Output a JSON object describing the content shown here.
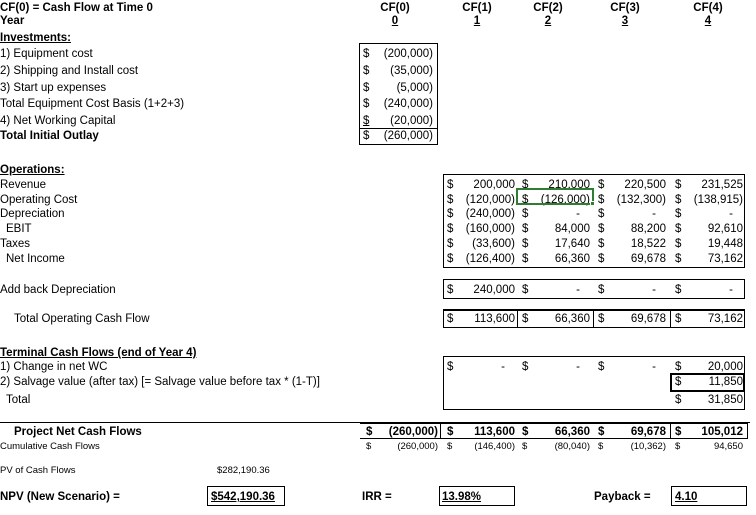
{
  "header": {
    "title": "CF(0) = Cash Flow at Time 0",
    "year_label": "Year",
    "columns": [
      {
        "label": "CF(0)",
        "year": "0"
      },
      {
        "label": "CF(1)",
        "year": "1"
      },
      {
        "label": "CF(2)",
        "year": "2"
      },
      {
        "label": "CF(3)",
        "year": "3"
      },
      {
        "label": "CF(4)",
        "year": "4"
      }
    ]
  },
  "investments": {
    "heading": "Investments:",
    "rows": [
      {
        "label": "1) Equipment cost",
        "value": "(200,000)"
      },
      {
        "label": "2) Shipping and Install cost",
        "value": "(35,000)"
      },
      {
        "label": "3) Start up expenses",
        "value": "(5,000)"
      },
      {
        "label": "Total Equipment Cost Basis (1+2+3)",
        "value": "(240,000)"
      },
      {
        "label": "4) Net Working Capital",
        "value": "(20,000)"
      }
    ],
    "total_label": "Total Initial Outlay",
    "total_value": "(260,000)"
  },
  "operations": {
    "heading": "Operations:",
    "rows": [
      {
        "label": "Revenue",
        "values": [
          "200,000",
          "210,000",
          "220,500",
          "231,525"
        ]
      },
      {
        "label": "Operating Cost",
        "values": [
          "(120,000)",
          "(126,000)",
          "(132,300)",
          "(138,915)"
        ]
      },
      {
        "label": "Depreciation",
        "values": [
          "(240,000)",
          "-",
          "-",
          "-"
        ]
      },
      {
        "label": "EBIT",
        "values": [
          "(160,000)",
          "84,000",
          "88,200",
          "92,610"
        ]
      },
      {
        "label": "Taxes",
        "values": [
          "(33,600)",
          "17,640",
          "18,522",
          "19,448"
        ]
      },
      {
        "label": "Net Income",
        "values": [
          "(126,400)",
          "66,360",
          "69,678",
          "73,162"
        ]
      }
    ],
    "add_back_label": "Add back  Depreciation",
    "add_back_values": [
      "240,000",
      "-",
      "-",
      "-"
    ],
    "total_label": "Total Operating Cash Flow",
    "total_values": [
      "113,600",
      "66,360",
      "69,678",
      "73,162"
    ]
  },
  "terminal": {
    "heading": "Terminal Cash Flows (end of Year 4)",
    "rows": [
      {
        "label": "1) Change in net WC",
        "values": [
          "-",
          "-",
          "-",
          "20,000"
        ]
      },
      {
        "label": "2) Salvage value (after tax) [= Salvage value before tax * (1-T)]",
        "values": [
          "",
          "",
          "",
          "11,850"
        ]
      }
    ],
    "total_label": "Total",
    "total_value": "31,850"
  },
  "project": {
    "net_label": "Project Net Cash Flows",
    "net_values": [
      "(260,000)",
      "113,600",
      "66,360",
      "69,678",
      "105,012"
    ],
    "cum_label": "Cumulative Cash Flows",
    "cum_values": [
      "(260,000)",
      "(146,400)",
      "(80,040)",
      "(10,362)",
      "94,650"
    ]
  },
  "summary": {
    "pv_label": "PV of Cash Flows",
    "pv_value": "$282,190.36",
    "npv_label": "NPV (New Scenario) =",
    "npv_value": "$542,190.36",
    "irr_label": "IRR =",
    "irr_value": "13.98%",
    "payback_label": "Payback =",
    "payback_value": "4.10"
  },
  "currency_symbol": "$",
  "colors": {
    "selection": "#2e7d32",
    "text": "#000000",
    "background": "#ffffff"
  }
}
